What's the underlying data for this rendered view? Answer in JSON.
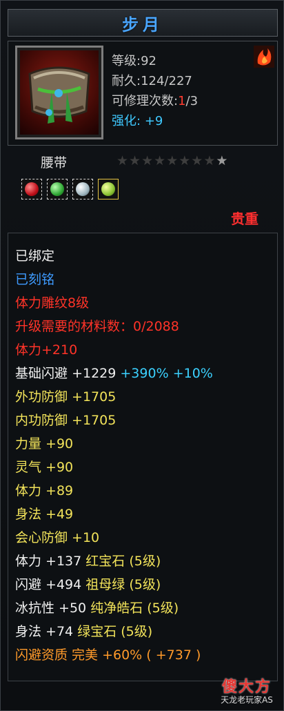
{
  "title": "步月",
  "stats": {
    "level_label": "等级:",
    "level_value": "92",
    "durability_label": "耐久:",
    "durability_value": "124/227",
    "repair_label": "可修理次数:",
    "repair_current": "1",
    "repair_rest": "/3",
    "strengthen_label": "强化:",
    "strengthen_value": "+9"
  },
  "item_type": "腰带",
  "stars": {
    "filled": 0,
    "total": 9
  },
  "rarity": "贵重",
  "attributes": [
    {
      "text": "已绑定",
      "color": "white"
    },
    {
      "text": "已刻铭",
      "color": "blue"
    },
    {
      "text": "体力雕纹8级",
      "color": "redl"
    },
    {
      "text": "升级需要的材料数：0/2088",
      "color": "redl"
    },
    {
      "text": "体力+210",
      "color": "redl"
    }
  ],
  "base_dodge": {
    "label": "基础闪避",
    "value": "+1229",
    "bonus1": "+390%",
    "bonus2": "+10%"
  },
  "yellow_attrs": [
    "外功防御 +1705",
    "内功防御 +1705",
    "力量 +90",
    "灵气 +90",
    "体力 +89",
    "身法 +49",
    "会心防御 +10"
  ],
  "gem_attrs": [
    {
      "stat": "体力 +137",
      "gem": "红宝石 (5级)"
    },
    {
      "stat": "闪避 +494",
      "gem": "祖母绿 (5级)"
    },
    {
      "stat": "冰抗性 +50",
      "gem": "纯净皓石 (5级)"
    },
    {
      "stat": "身法 +74",
      "gem": "绿宝石 (5级)"
    }
  ],
  "quality": "闪避资质  完美 +60% ( +737 )",
  "watermark": {
    "top": "傻大方",
    "bottom": "天龙老玩家AS"
  },
  "colors": {
    "title": "#4aa6ff",
    "rarity": "#ff2f2f",
    "attr_yellow": "#f2e35a",
    "quality_orange": "#ff9a2a"
  },
  "icons": [
    "belt-item-icon",
    "fire-emblem-icon",
    "star-icon",
    "gem-slot-icon"
  ]
}
